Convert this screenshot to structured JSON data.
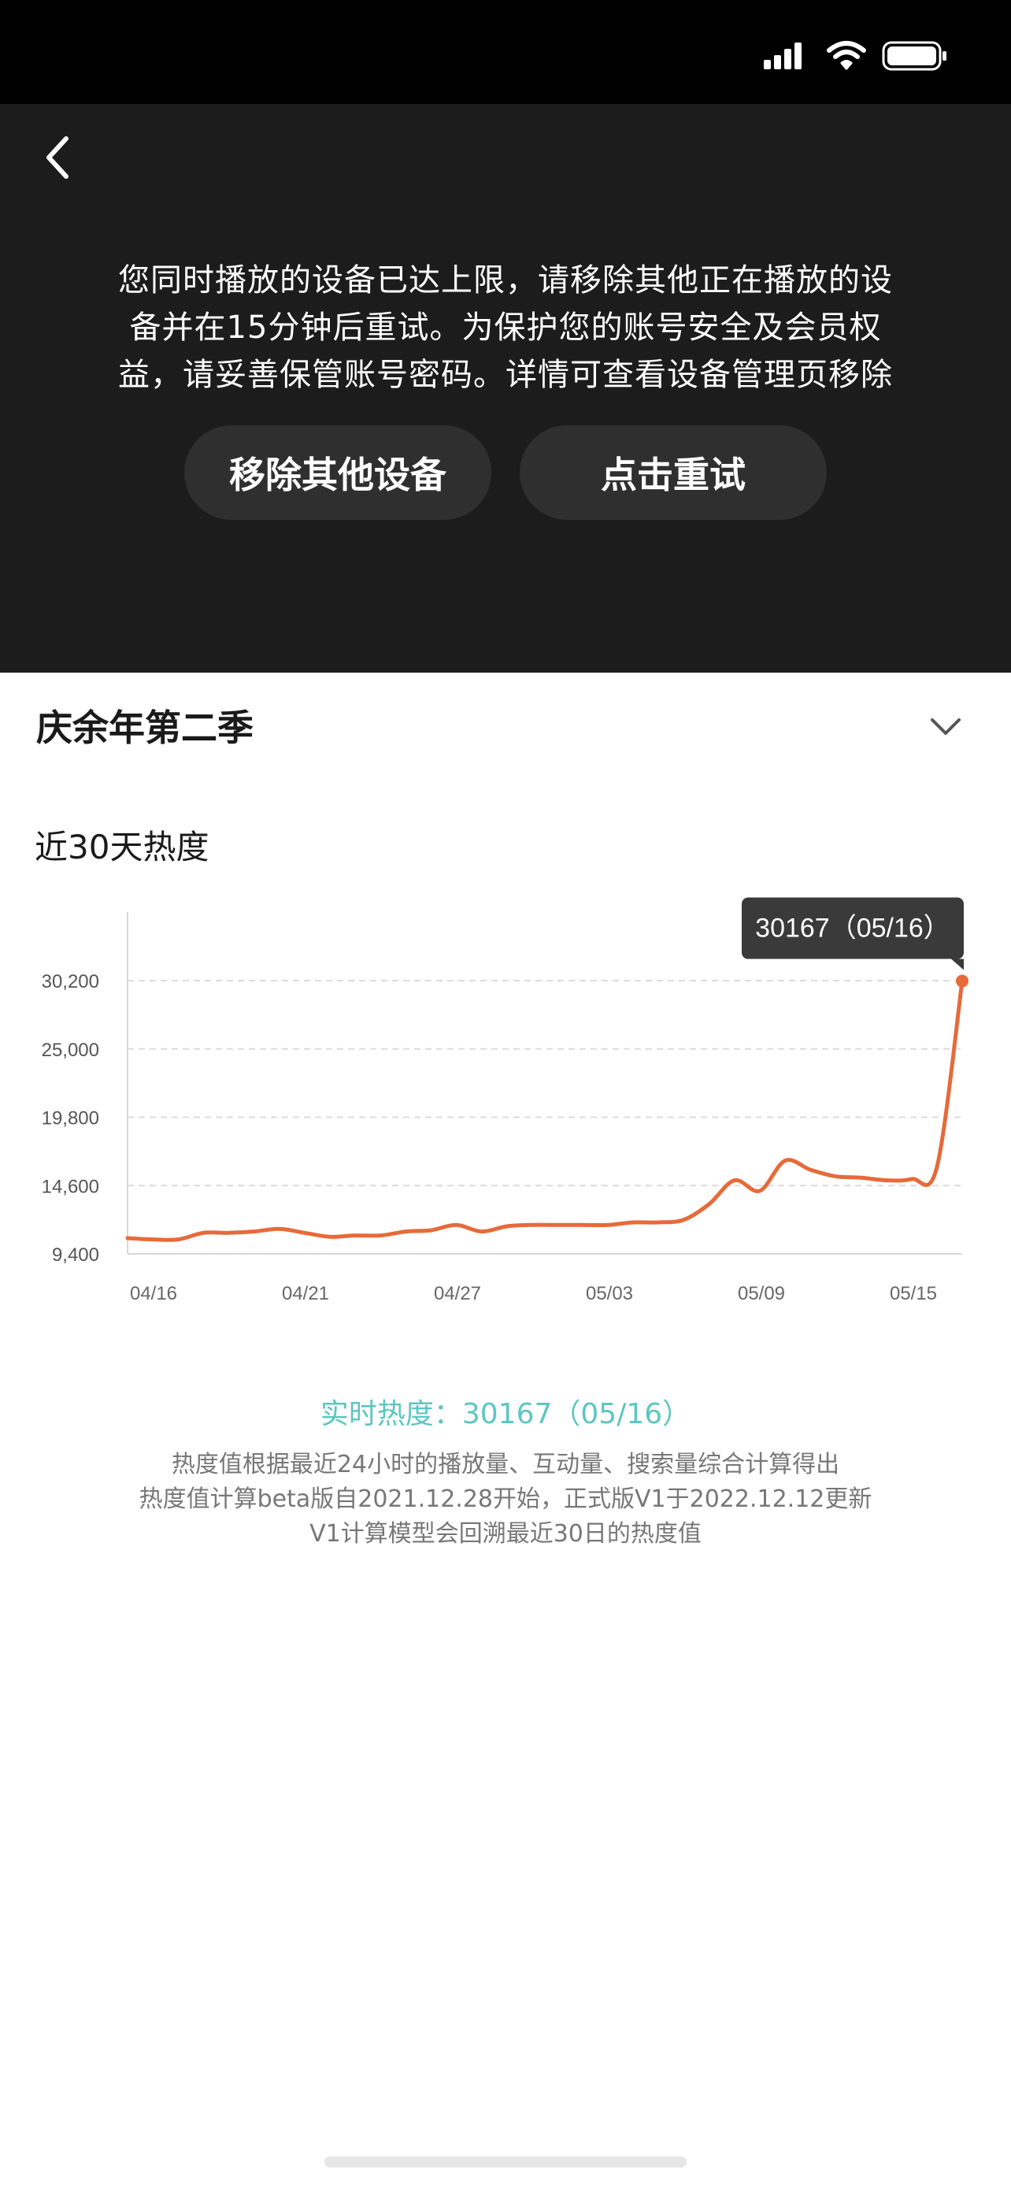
{
  "status_bar": {
    "signal_icon": "cellular-signal-icon",
    "wifi_icon": "wifi-icon",
    "battery_icon": "battery-icon"
  },
  "player": {
    "back_icon": "chevron-left-icon",
    "error_lines": [
      "您同时播放的设备已达上限，请移除其他正在播放的设",
      "备并在15分钟后重试。为保护您的账号安全及会员权",
      "益，请妥善保管账号密码。详情可查看设备管理页移除"
    ],
    "remove_devices_label": "移除其他设备",
    "retry_label": "点击重试"
  },
  "show": {
    "title": "庆余年第二季",
    "expand_icon": "chevron-down-icon"
  },
  "heat": {
    "section_title": "近30天热度",
    "realtime_label": "实时热度：30167（05/16）",
    "notes": [
      "热度值根据最近24小时的播放量、互动量、搜索量综合计算得出",
      "热度值计算beta版自2021.12.28开始，正式版V1于2022.12.12更新",
      "V1计算模型会回溯最近30日的热度值"
    ]
  },
  "colors": {
    "line": "#e66a3a",
    "accent": "#5cc6c2",
    "tooltip_bg": "#3a3a3a"
  },
  "chart_data": {
    "type": "line",
    "title": "近30天热度",
    "x_tick_labels": [
      "04/16",
      "04/21",
      "04/27",
      "05/03",
      "05/09",
      "05/15"
    ],
    "y_tick_labels": [
      "30,200",
      "25,000",
      "19,800",
      "14,600",
      "9,400"
    ],
    "ylim": [
      9400,
      30200
    ],
    "grid": true,
    "series": [
      {
        "values": [
          10600,
          10500,
          10500,
          11000,
          11000,
          11100,
          11300,
          11000,
          10700,
          10800,
          10800,
          11100,
          11200,
          11600,
          11100,
          11500,
          11600,
          11600,
          11600,
          11600,
          11800,
          11800,
          12000,
          13200,
          15000,
          14200,
          16500,
          15800,
          15300,
          15200,
          15000,
          15100,
          16000,
          30167
        ]
      }
    ],
    "tooltip": "30167（05/16）",
    "highlight": {
      "index": 33,
      "value": 30167
    }
  }
}
